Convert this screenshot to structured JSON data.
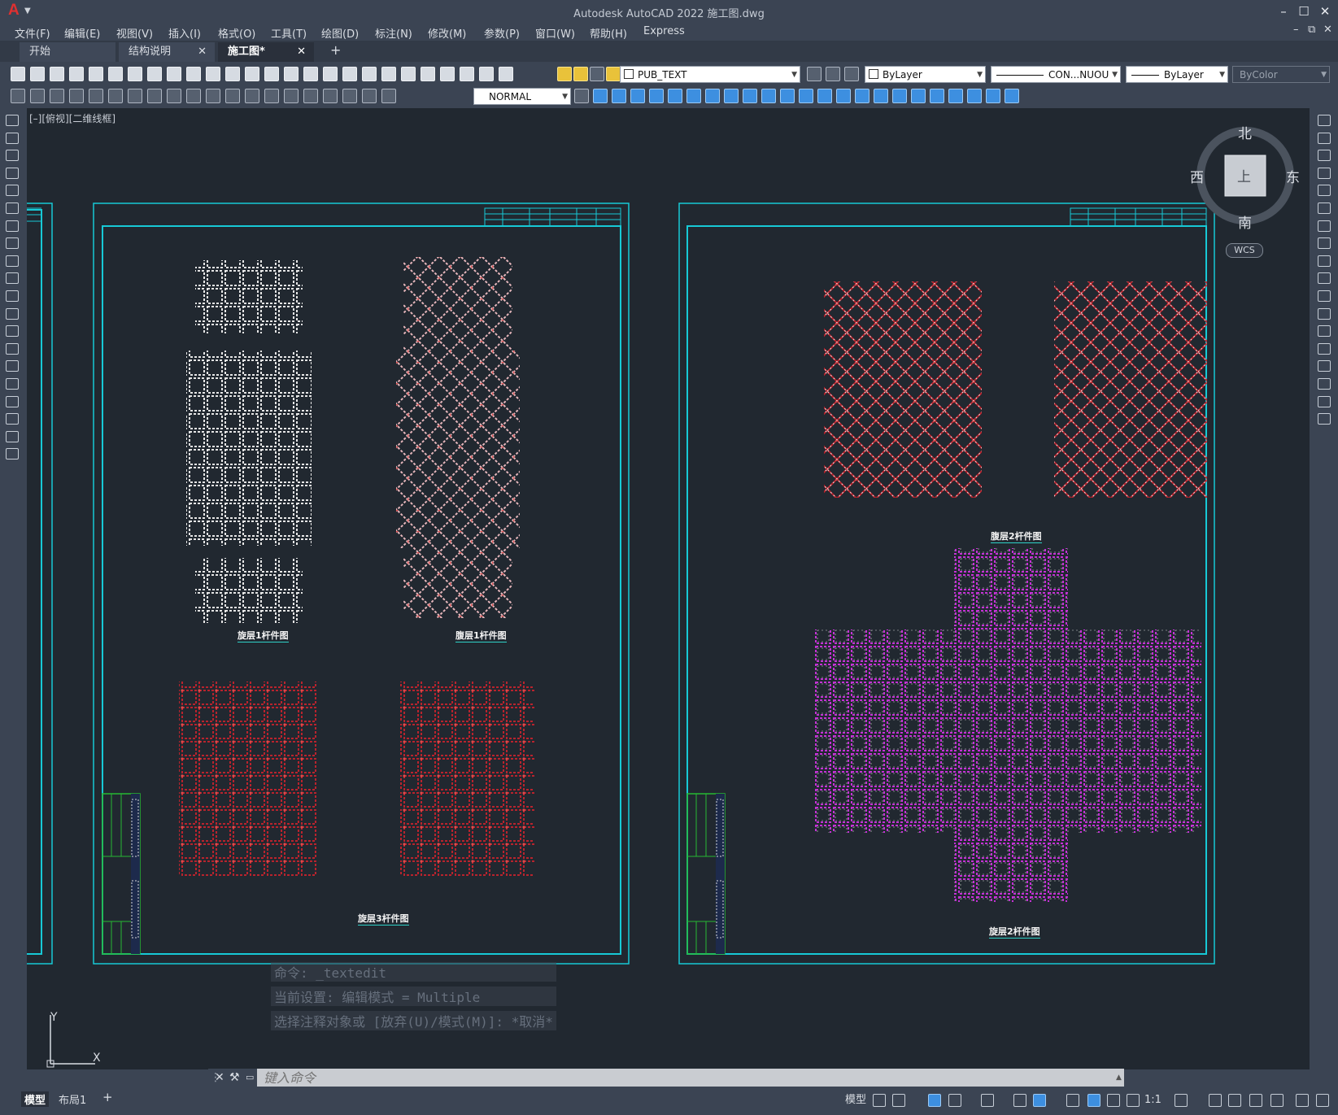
{
  "titlebar": {
    "app_logo": "A",
    "title": "Autodesk AutoCAD 2022     施工图.dwg",
    "minimize": "–",
    "maximize": "☐",
    "close": "✕"
  },
  "menubar": {
    "items": [
      "文件(F)",
      "编辑(E)",
      "视图(V)",
      "插入(I)",
      "格式(O)",
      "工具(T)",
      "绘图(D)",
      "标注(N)",
      "修改(M)",
      "参数(P)",
      "窗口(W)",
      "帮助(H)",
      "Express"
    ],
    "doc_min": "–",
    "doc_restore": "⧉",
    "doc_close": "✕"
  },
  "tabs": [
    {
      "label": "开始",
      "closable": false,
      "active": false
    },
    {
      "label": "结构说明",
      "closable": true,
      "active": false
    },
    {
      "label": "施工图*",
      "closable": true,
      "active": true
    }
  ],
  "tab_close": "✕",
  "tab_add": "+",
  "toolbar": {
    "layer": "PUB_TEXT",
    "color": "ByLayer",
    "linetype": "CON...NUOU",
    "lineweight": "ByLayer",
    "plotstyle": "ByColor",
    "dimstyle": "NORMAL"
  },
  "viewport": {
    "label": "[–][俯视][二维线框]"
  },
  "viewcube": {
    "north": "北",
    "south": "南",
    "east": "东",
    "west": "西",
    "face": "上",
    "wcs": "WCS"
  },
  "drawing": {
    "captions": [
      "旋层1杆件图",
      "腹层1杆件图",
      "旋层3杆件图",
      "腹层2杆件图",
      "旋层2杆件图"
    ]
  },
  "ucs": {
    "x": "X",
    "y": "Y"
  },
  "command": {
    "history": [
      "命令: _textedit",
      "当前设置: 编辑模式 = Multiple",
      "选择注释对象或 [放弃(U)/模式(M)]: *取消*"
    ],
    "placeholder": "键入命令"
  },
  "statusbar": {
    "layouts": [
      "模型",
      "布局1"
    ],
    "add_layout": "+",
    "model_button": "模型",
    "scale": "1:1"
  },
  "colors": {
    "canvas": "#212830",
    "chrome": "#3b4453",
    "frame": "#17c9d6",
    "mesh_white": "#e6e6e6",
    "mesh_pink": "#e8b8bd",
    "mesh_red": "#b8232d",
    "mesh_magenta": "#c531d6",
    "titleblock_green": "#27b833"
  }
}
